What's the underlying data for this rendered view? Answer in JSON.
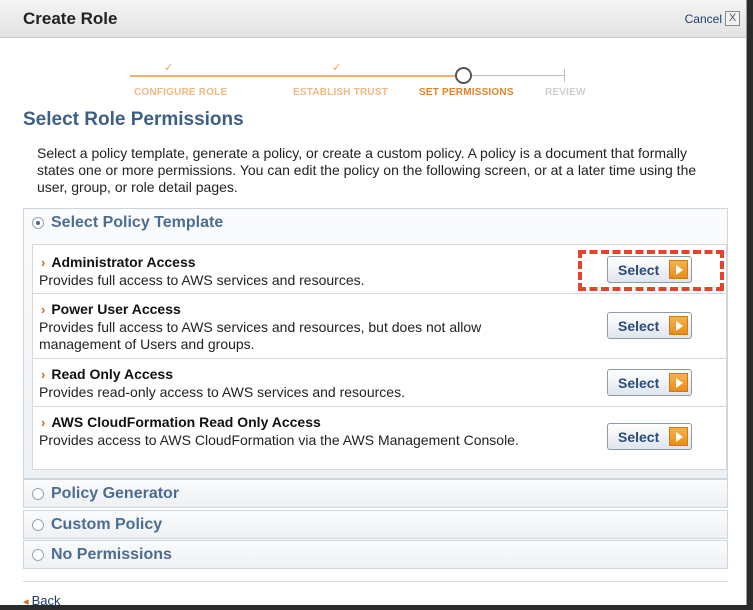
{
  "dialog": {
    "title": "Create Role",
    "cancel_label": "Cancel",
    "close_glyph": "X"
  },
  "wizard": {
    "steps": [
      {
        "label": "CONFIGURE ROLE",
        "state": "done"
      },
      {
        "label": "ESTABLISH TRUST",
        "state": "done"
      },
      {
        "label": "SET PERMISSIONS",
        "state": "current"
      },
      {
        "label": "REVIEW",
        "state": "future"
      }
    ],
    "check_glyph": "✓"
  },
  "section": {
    "heading": "Select Role Permissions",
    "intro": "Select a policy template, generate a policy, or create a custom policy. A policy is a document that formally states one or more permissions. You can edit the policy on the following screen, or at a later time using the user, group, or role detail pages."
  },
  "options": [
    {
      "label": "Select Policy Template",
      "selected": true
    },
    {
      "label": "Policy Generator",
      "selected": false
    },
    {
      "label": "Custom Policy",
      "selected": false
    },
    {
      "label": "No Permissions",
      "selected": false
    }
  ],
  "policies": [
    {
      "name": "Administrator Access",
      "description": "Provides full access to AWS services and resources.",
      "button": "Select"
    },
    {
      "name": "Power User Access",
      "description": "Provides full access to AWS services and resources, but does not allow management of Users and groups.",
      "button": "Select"
    },
    {
      "name": "Read Only Access",
      "description": "Provides read-only access to AWS services and resources.",
      "button": "Select"
    },
    {
      "name": "AWS CloudFormation Read Only Access",
      "description": "Provides access to AWS CloudFormation via the AWS Management Console.",
      "button": "Select"
    }
  ],
  "footer": {
    "back_label": "Back"
  },
  "colors": {
    "accent": "#e8802a",
    "heading": "#3d5f86",
    "highlight": "#e8412c"
  }
}
